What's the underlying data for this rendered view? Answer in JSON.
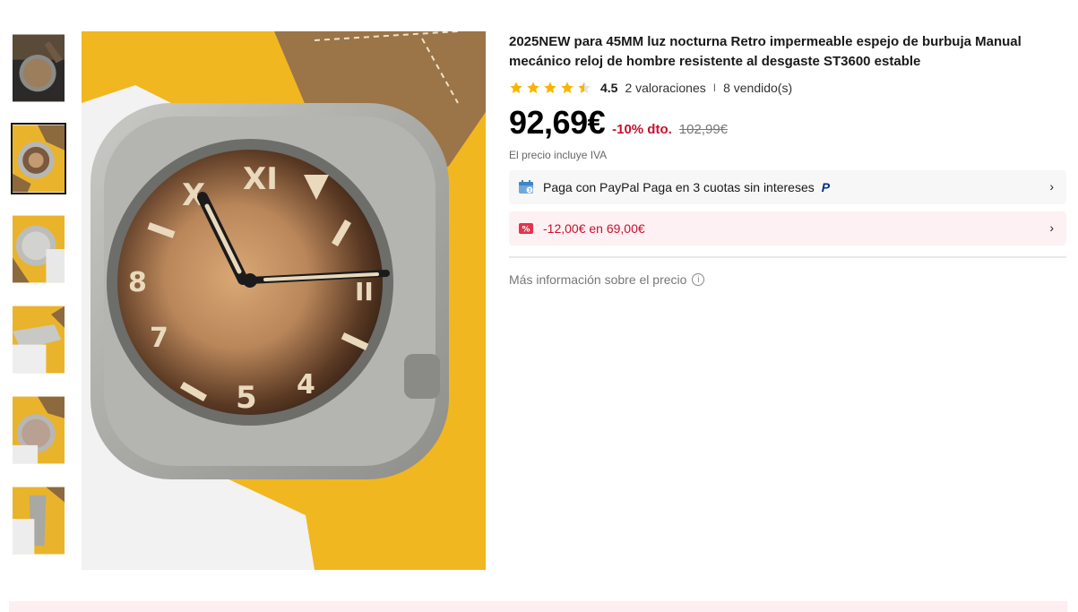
{
  "product": {
    "title": "2025NEW para 45MM luz nocturna Retro impermeable espejo de burbuja Manual mecánico reloj de hombre resistente al desgaste ST3600 estable",
    "rating": "4.5",
    "reviews": "2 valoraciones",
    "separator": "I",
    "sold": "8 vendido(s)",
    "price": "92,69€",
    "discount": "-10% dto.",
    "old_price": "102,99€",
    "vat_note": "El precio incluye IVA"
  },
  "payment": {
    "paypal_text": "Paga con PayPal Paga en 3 cuotas sin intereses",
    "paypal_mark": "P",
    "chevron": "›"
  },
  "coupon": {
    "badge": "%",
    "text": "-12,00€ en 69,00€",
    "chevron": "›"
  },
  "more_info": {
    "label": "Más información sobre el precio",
    "icon": "i"
  },
  "colors": {
    "accent_red": "#c8102e",
    "star": "#f7b500",
    "paypal_blue": "#003087"
  },
  "gallery": {
    "thumbnail_count": 6,
    "active_index": 1
  }
}
